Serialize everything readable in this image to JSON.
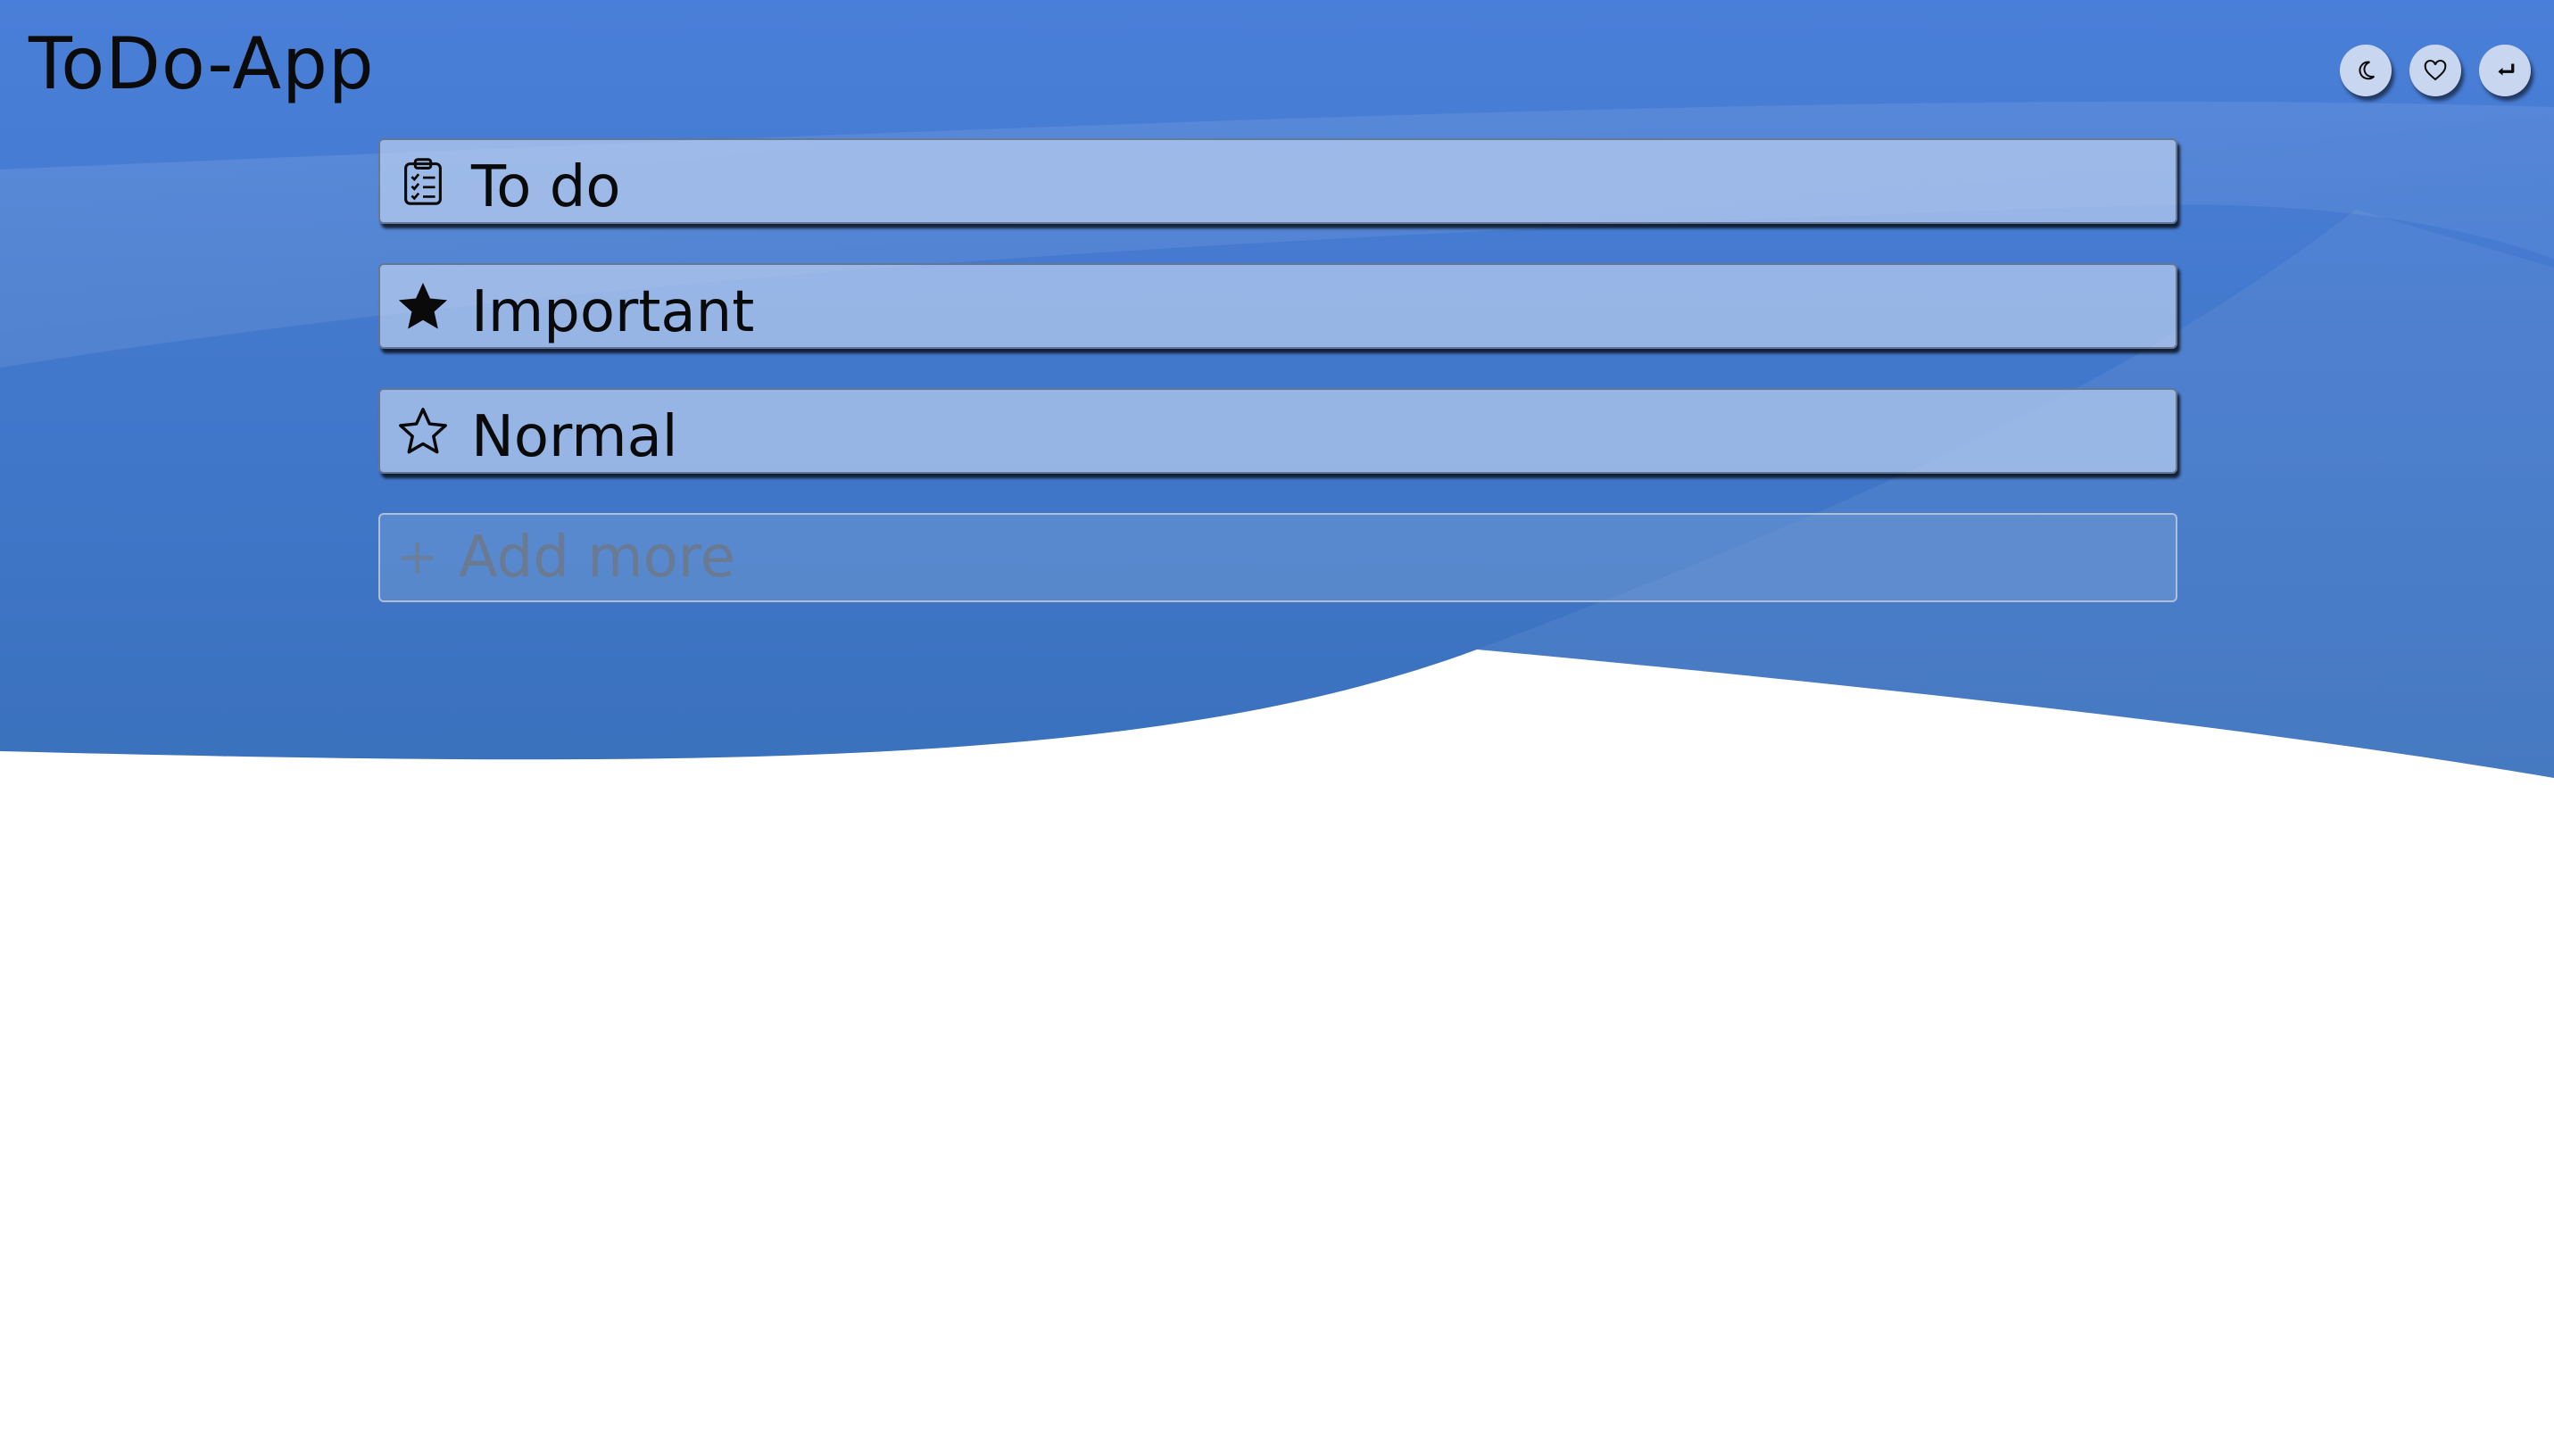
{
  "app": {
    "title": "ToDo-App"
  },
  "header": {
    "actions": [
      {
        "name": "dark-mode",
        "icon": "moon-icon",
        "glyph": "☾"
      },
      {
        "name": "favorites",
        "icon": "heart-icon",
        "glyph": "♡"
      },
      {
        "name": "logout",
        "icon": "return-icon",
        "glyph": "↵"
      }
    ]
  },
  "lists": [
    {
      "label": "To do",
      "icon": "clipboard-checklist-icon"
    },
    {
      "label": "Important",
      "icon": "star-filled-icon"
    },
    {
      "label": "Normal",
      "icon": "star-outline-icon"
    }
  ],
  "add_more": {
    "icon": "plus-icon",
    "plus_glyph": "+",
    "placeholder": "Add more"
  },
  "colors": {
    "background_blue": "#4a7fd6",
    "card_fill": "#a9c1ea",
    "text": "#0a0a0a",
    "placeholder": "#6a7a92"
  }
}
